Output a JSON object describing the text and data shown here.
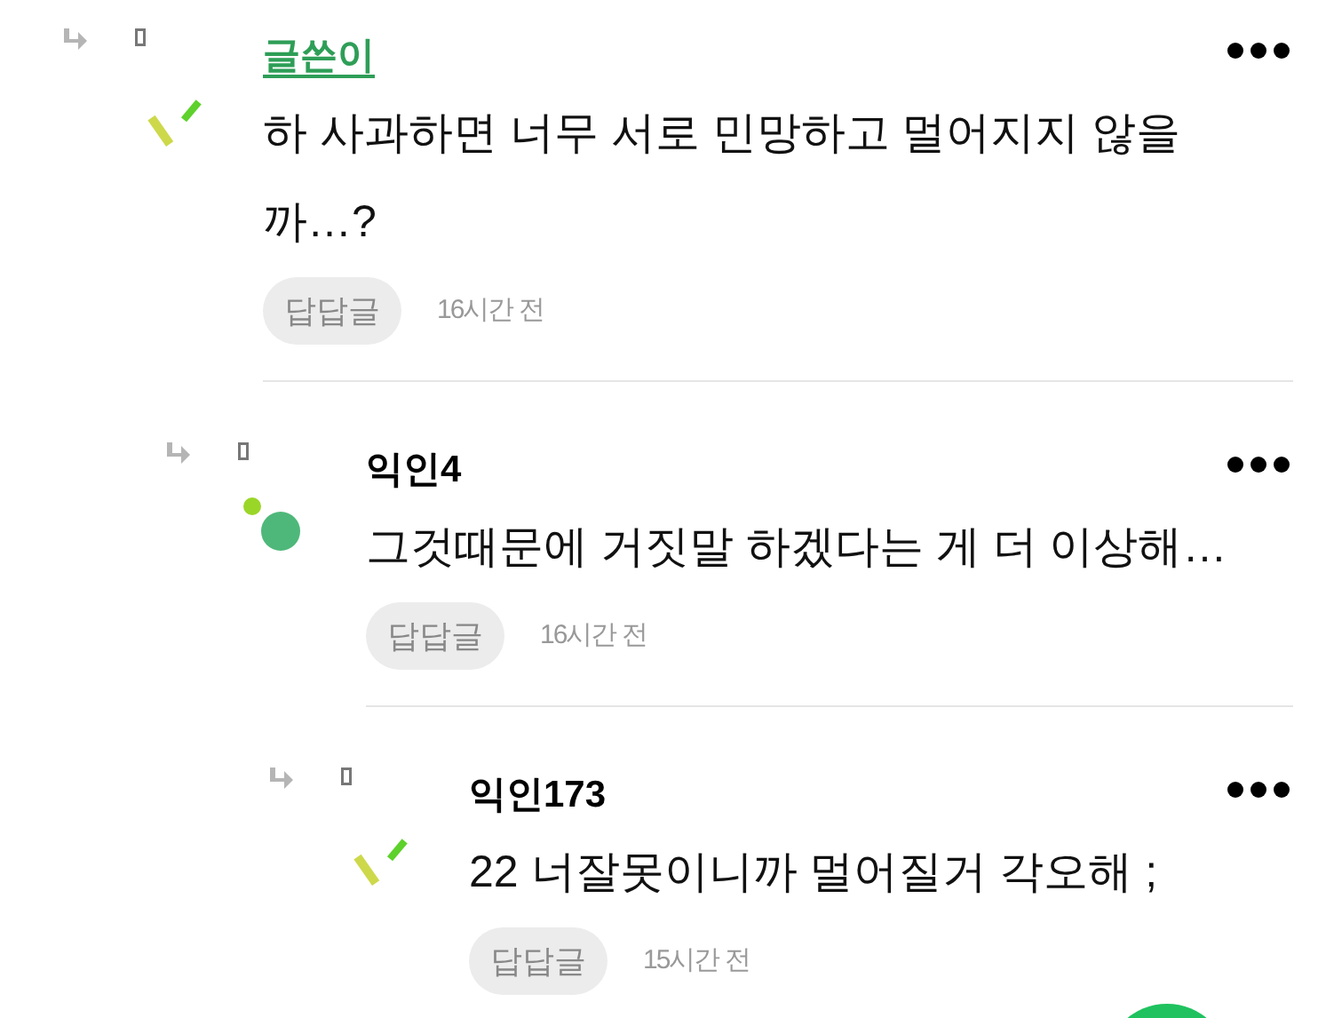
{
  "comments": [
    {
      "author": "글쓴이",
      "is_author": true,
      "kind": "sticks",
      "body": "하 사과하면 너무 서로 민망하고 멀어지지 않을까…?",
      "reply_button": "답답글",
      "time": "16시간 전",
      "children": [
        {
          "author": "익인4",
          "is_author": false,
          "kind": "dots",
          "body": "그것때문에 거짓말 하겠다는 게 더 이상해…",
          "reply_button": "답답글",
          "time": "16시간 전",
          "children": [
            {
              "author": "익인173",
              "is_author": false,
              "kind": "sticks",
              "body": "22 너잘못이니까 멀어질거 각오해 ;",
              "reply_button": "답답글",
              "time": "15시간 전"
            }
          ]
        }
      ]
    }
  ]
}
